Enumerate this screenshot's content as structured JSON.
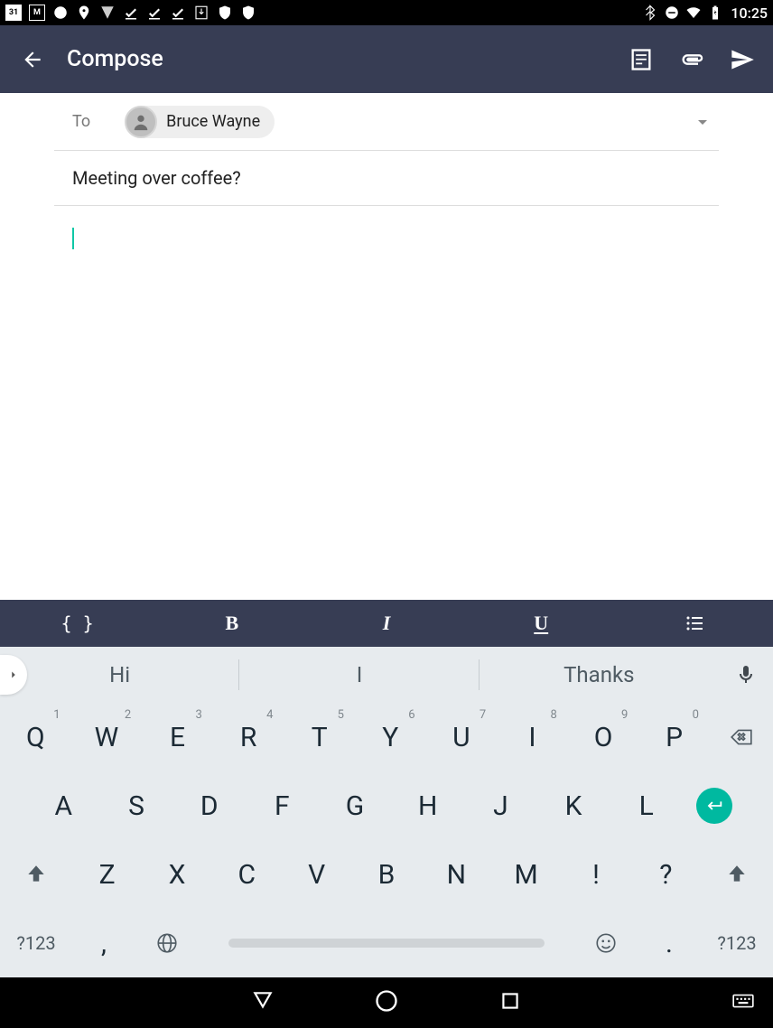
{
  "status": {
    "calendar_day": "31",
    "time": "10:25"
  },
  "appbar": {
    "title": "Compose"
  },
  "compose": {
    "to_label": "To",
    "recipient_name": "Bruce Wayne",
    "subject": "Meeting over coffee?"
  },
  "format": {
    "braces": "{ }",
    "bold": "B",
    "italic": "I",
    "underline": "U"
  },
  "keyboard": {
    "suggestions": [
      "Hi",
      "I",
      "Thanks"
    ],
    "row1": [
      {
        "k": "Q",
        "h": "1"
      },
      {
        "k": "W",
        "h": "2"
      },
      {
        "k": "E",
        "h": "3"
      },
      {
        "k": "R",
        "h": "4"
      },
      {
        "k": "T",
        "h": "5"
      },
      {
        "k": "Y",
        "h": "6"
      },
      {
        "k": "U",
        "h": "7"
      },
      {
        "k": "I",
        "h": "8"
      },
      {
        "k": "O",
        "h": "9"
      },
      {
        "k": "P",
        "h": "0"
      }
    ],
    "row2": [
      "A",
      "S",
      "D",
      "F",
      "G",
      "H",
      "J",
      "K",
      "L"
    ],
    "row3": [
      "Z",
      "X",
      "C",
      "V",
      "B",
      "N",
      "M",
      "!",
      "?"
    ],
    "symkey": "?123",
    "comma": ",",
    "period": "."
  }
}
